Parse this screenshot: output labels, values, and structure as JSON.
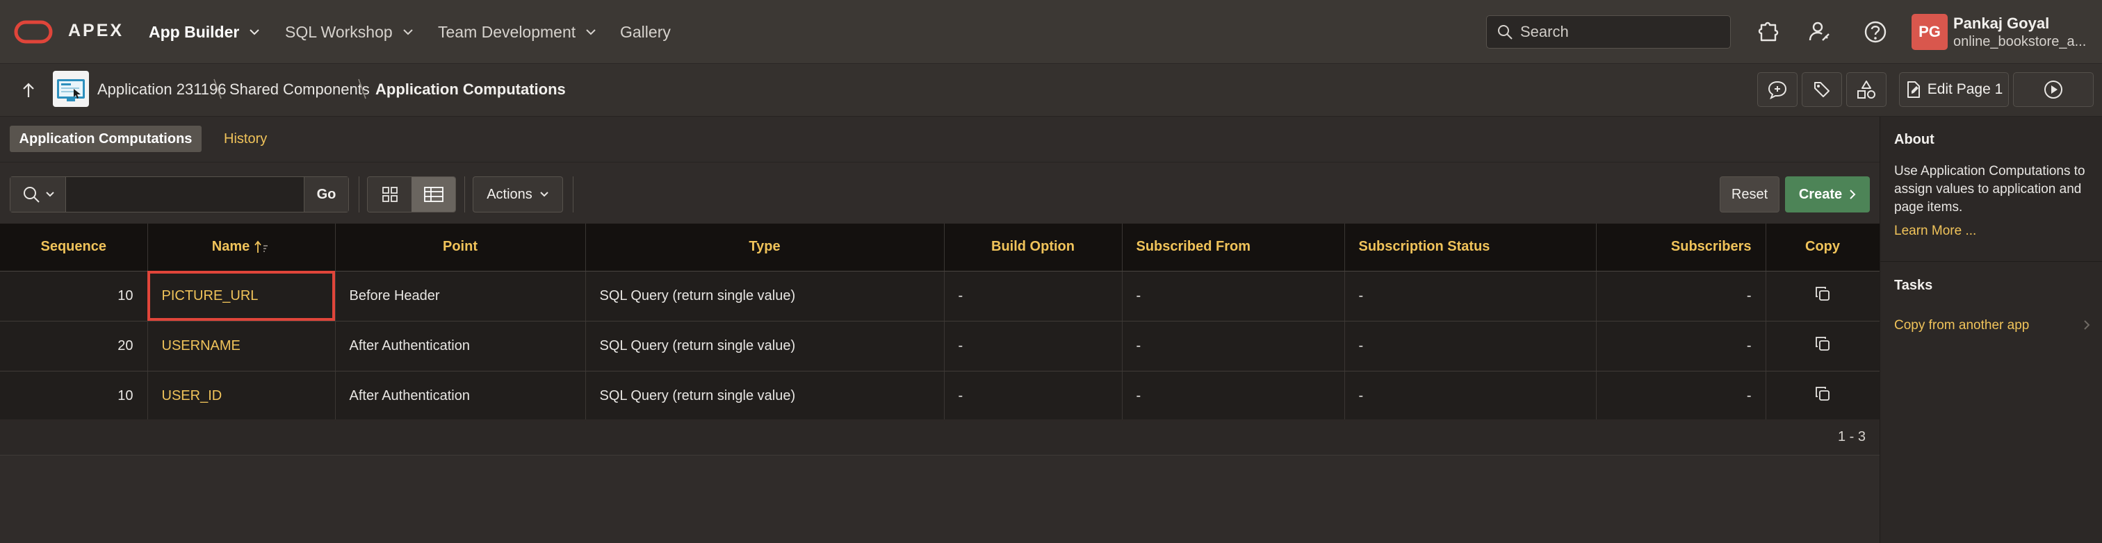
{
  "header": {
    "brand": "APEX",
    "nav": [
      {
        "label": "App Builder",
        "has_menu": true,
        "active": true
      },
      {
        "label": "SQL Workshop",
        "has_menu": true,
        "active": false
      },
      {
        "label": "Team Development",
        "has_menu": true,
        "active": false
      },
      {
        "label": "Gallery",
        "has_menu": false,
        "active": false
      }
    ],
    "search_placeholder": "Search",
    "icons": [
      "extensions-icon",
      "admin-icon",
      "help-icon"
    ],
    "user": {
      "initials": "PG",
      "name": "Pankaj Goyal",
      "workspace": "online_bookstore_a..."
    }
  },
  "breadcrumb": {
    "items": [
      "Application 231196",
      "Shared Components",
      "Application Computations"
    ],
    "tools": [
      "comments-icon",
      "developer-tools-icon",
      "shapes-icon"
    ],
    "edit_page_label": "Edit Page 1",
    "run_icon": "play-icon"
  },
  "tabs": {
    "active": "Application Computations",
    "other": "History"
  },
  "toolbar": {
    "search_value": "",
    "go_label": "Go",
    "actions_label": "Actions",
    "reset_label": "Reset",
    "create_label": "Create"
  },
  "table": {
    "columns": [
      "Sequence",
      "Name",
      "Point",
      "Type",
      "Build Option",
      "Subscribed From",
      "Subscription Status",
      "Subscribers",
      "Copy"
    ],
    "rows": [
      {
        "sequence": "10",
        "name": "PICTURE_URL",
        "point": "Before Header",
        "type": "SQL Query (return single value)",
        "build_option": "-",
        "subscribed_from": "-",
        "subscription_status": "-",
        "subscribers": "-"
      },
      {
        "sequence": "20",
        "name": "USERNAME",
        "point": "After Authentication",
        "type": "SQL Query (return single value)",
        "build_option": "-",
        "subscribed_from": "-",
        "subscription_status": "-",
        "subscribers": "-"
      },
      {
        "sequence": "10",
        "name": "USER_ID",
        "point": "After Authentication",
        "type": "SQL Query (return single value)",
        "build_option": "-",
        "subscribed_from": "-",
        "subscription_status": "-",
        "subscribers": "-"
      }
    ],
    "pagination": "1 - 3"
  },
  "sidebar": {
    "about_title": "About",
    "about_text": "Use Application Computations to assign values to application and page items.",
    "learn_more": "Learn More ...",
    "tasks_title": "Tasks",
    "task_link": "Copy from another app"
  },
  "colors": {
    "accent": "#f0c35a",
    "create": "#4d8457",
    "avatar": "#d9574d",
    "highlight": "#e0453a"
  }
}
